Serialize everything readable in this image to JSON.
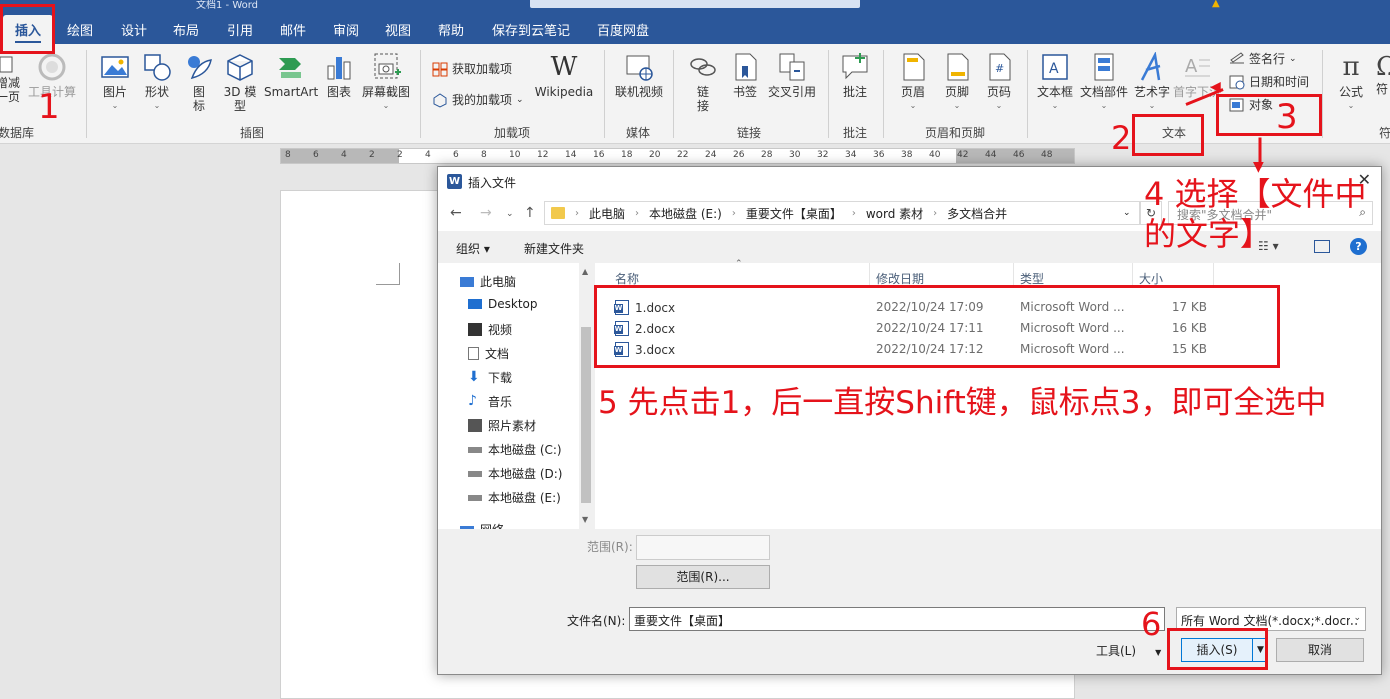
{
  "title_bar": {
    "doc_title": "文档1 - Word"
  },
  "tabs": [
    "插入",
    "绘图",
    "设计",
    "布局",
    "引用",
    "邮件",
    "审阅",
    "视图",
    "帮助",
    "保存到云笔记",
    "百度网盘"
  ],
  "ribbon": {
    "left_cut": {
      "line1": "增减",
      "line2": "一页",
      "tool": "工具计算",
      "group": "数据库"
    },
    "illustrations": {
      "items": [
        "图片",
        "形状",
        "图",
        "标",
        "3D 模",
        "型",
        "SmartArt",
        "图表",
        "屏幕截图"
      ],
      "group": "插图"
    },
    "addins": {
      "get": "获取加载项",
      "mine": "我的加载项",
      "wiki": "Wikipedia",
      "group": "加载项"
    },
    "media": {
      "online_video": "联机视频",
      "group": "媒体"
    },
    "links": {
      "link1": "链",
      "link2": "接",
      "bookmark": "书签",
      "crossref": "交叉引用",
      "group": "链接"
    },
    "comments": {
      "comment": "批注",
      "group": "批注"
    },
    "header_footer": {
      "header": "页眉",
      "footer": "页脚",
      "page_num": "页码",
      "group": "页眉和页脚"
    },
    "text": {
      "textbox": "文本框",
      "parts": "文档部件",
      "wordart": "艺术字",
      "dropcap": "首字下沉",
      "signature": "签名行",
      "datetime": "日期和时间",
      "object": "对象",
      "group": "文本"
    },
    "symbols": {
      "equation": "公式",
      "symbol": "符",
      "group": "符"
    }
  },
  "ruler": {
    "ticks": [
      "8",
      "6",
      "4",
      "2",
      "2",
      "4",
      "6",
      "8",
      "10",
      "12",
      "14",
      "16",
      "18",
      "20",
      "22",
      "24",
      "26",
      "28",
      "30",
      "32",
      "34",
      "36",
      "38",
      "40",
      "42",
      "44",
      "46",
      "48"
    ]
  },
  "dialog": {
    "title": "插入文件",
    "breadcrumb": [
      "此电脑",
      "本地磁盘 (E:)",
      "重要文件【桌面】",
      "word 素材",
      "多文档合并"
    ],
    "search_placeholder": "搜索\"多文档合并\"",
    "organize": "组织 ▾",
    "new_folder": "新建文件夹",
    "nav": [
      "此电脑",
      "Desktop",
      "视频",
      "文档",
      "下载",
      "音乐",
      "照片素材",
      "本地磁盘 (C:)",
      "本地磁盘 (D:)",
      "本地磁盘 (E:)",
      "网络"
    ],
    "columns": [
      "名称",
      "修改日期",
      "类型",
      "大小"
    ],
    "files": [
      {
        "name": "1.docx",
        "date": "2022/10/24 17:09",
        "type": "Microsoft Word ...",
        "size": "17 KB"
      },
      {
        "name": "2.docx",
        "date": "2022/10/24 17:11",
        "type": "Microsoft Word ...",
        "size": "16 KB"
      },
      {
        "name": "3.docx",
        "date": "2022/10/24 17:12",
        "type": "Microsoft Word ...",
        "size": "15 KB"
      }
    ],
    "range_label": "范围(R):",
    "range_button": "范围(R)...",
    "filename_label": "文件名(N):",
    "filename_value": "重要文件【桌面】",
    "filter_value": "所有 Word 文档(*.docx;*.docm",
    "tools": "工具(L)",
    "insert": "插入(S)",
    "cancel": "取消"
  },
  "annotations": {
    "n1": "1",
    "n2": "2",
    "n3": "3",
    "step4_line1": "4  选择【文件中",
    "step4_line2": "的文字】",
    "step5": "5  先点击1，后一直按Shift键，鼠标点3，即可全选中",
    "n6": "6"
  },
  "colors": {
    "word_blue": "#2b579a",
    "annotation_red": "#e5131b",
    "selection": "#cce4f7"
  }
}
